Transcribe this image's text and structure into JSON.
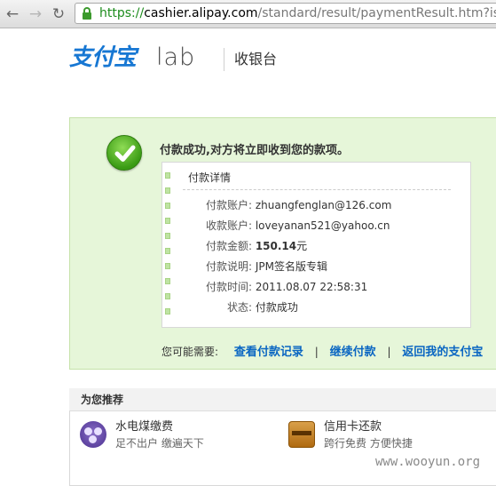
{
  "browser": {
    "back_icon": "back-arrow-icon",
    "forward_icon": "forward-arrow-icon",
    "reload_icon": "reload-icon",
    "url_scheme": "https://",
    "url_host": "cashier.alipay.com",
    "url_path": "/standard/result/paymentResult.htm?isSettle"
  },
  "header": {
    "logo_text": "支付宝",
    "logo_lab": "lab",
    "title": "收银台"
  },
  "result": {
    "message": "付款成功,对方将立即收到您的款项。",
    "details_title": "付款详情",
    "rows": [
      {
        "label": "付款账户:",
        "value": "zhuangfenglan@126.com"
      },
      {
        "label": "收款账户:",
        "value": "loveyanan521@yahoo.cn"
      },
      {
        "label": "付款金额:",
        "value": "150.14",
        "unit": "元"
      },
      {
        "label": "付款说明:",
        "value": "JPM签名版专辑"
      },
      {
        "label": "付款时间:",
        "value": "2011.08.07 22:58:31"
      },
      {
        "label": "状态:",
        "value": "付款成功"
      }
    ],
    "links_label": "您可能需要:",
    "links": [
      "查看付款记录",
      "继续付款",
      "返回我的支付宝"
    ],
    "link_separator": "|"
  },
  "recommend": {
    "title": "为您推荐",
    "items": [
      {
        "name": "水电煤缴费",
        "desc": "足不出户  缴遍天下",
        "icon": "utility-payment-icon"
      },
      {
        "name": "信用卡还款",
        "desc": "跨行免费  方便快捷",
        "icon": "credit-card-icon"
      }
    ]
  },
  "watermark": "www.wooyun.org",
  "colors": {
    "success_bg": "#e6f6d9",
    "link": "#0a66c2",
    "amount": "#f26f00"
  }
}
